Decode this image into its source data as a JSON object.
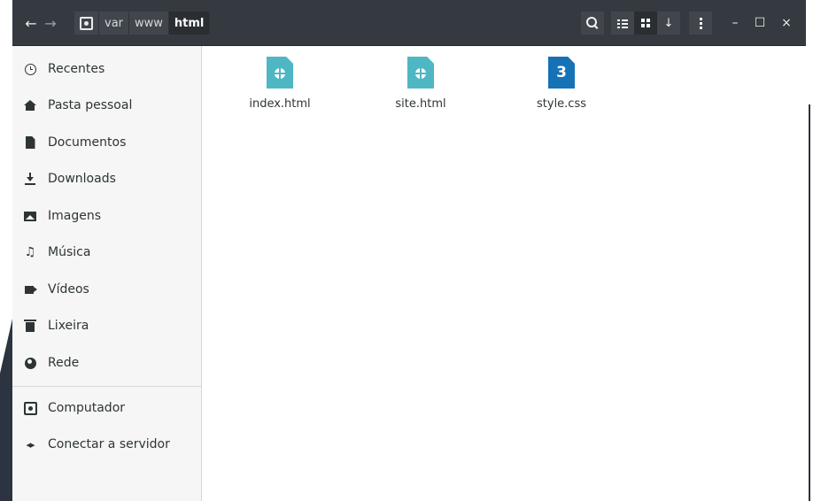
{
  "headerbar": {
    "nav_back": "←",
    "nav_forward": "→",
    "path": [
      "var",
      "www",
      "html"
    ],
    "active_segment": "html",
    "view_mode": "grid",
    "window_controls": {
      "minimize": "–",
      "maximize": "☐",
      "close": "×"
    }
  },
  "sidebar": {
    "items": [
      {
        "label": "Recentes",
        "icon": "clock-icon"
      },
      {
        "label": "Pasta pessoal",
        "icon": "home-icon"
      },
      {
        "label": "Documentos",
        "icon": "document-icon"
      },
      {
        "label": "Downloads",
        "icon": "download-icon"
      },
      {
        "label": "Imagens",
        "icon": "image-icon"
      },
      {
        "label": "Música",
        "icon": "music-icon"
      },
      {
        "label": "Vídeos",
        "icon": "video-icon"
      },
      {
        "label": "Lixeira",
        "icon": "trash-icon"
      },
      {
        "label": "Rede",
        "icon": "network-icon"
      }
    ],
    "devices": [
      {
        "label": "Computador",
        "icon": "computer-icon"
      },
      {
        "label": "Conectar a servidor",
        "icon": "connect-server-icon"
      }
    ]
  },
  "files": [
    {
      "name": "index.html",
      "type": "html",
      "icon": "html-file-icon"
    },
    {
      "name": "site.html",
      "type": "html",
      "icon": "html-file-icon"
    },
    {
      "name": "style.css",
      "type": "css",
      "icon": "css-file-icon",
      "badge": "3"
    }
  ],
  "colors": {
    "headerbar": "#353a40",
    "sidebar": "#f6f6f6",
    "html_icon": "#4fb7c4",
    "css_icon": "#1572b6"
  }
}
